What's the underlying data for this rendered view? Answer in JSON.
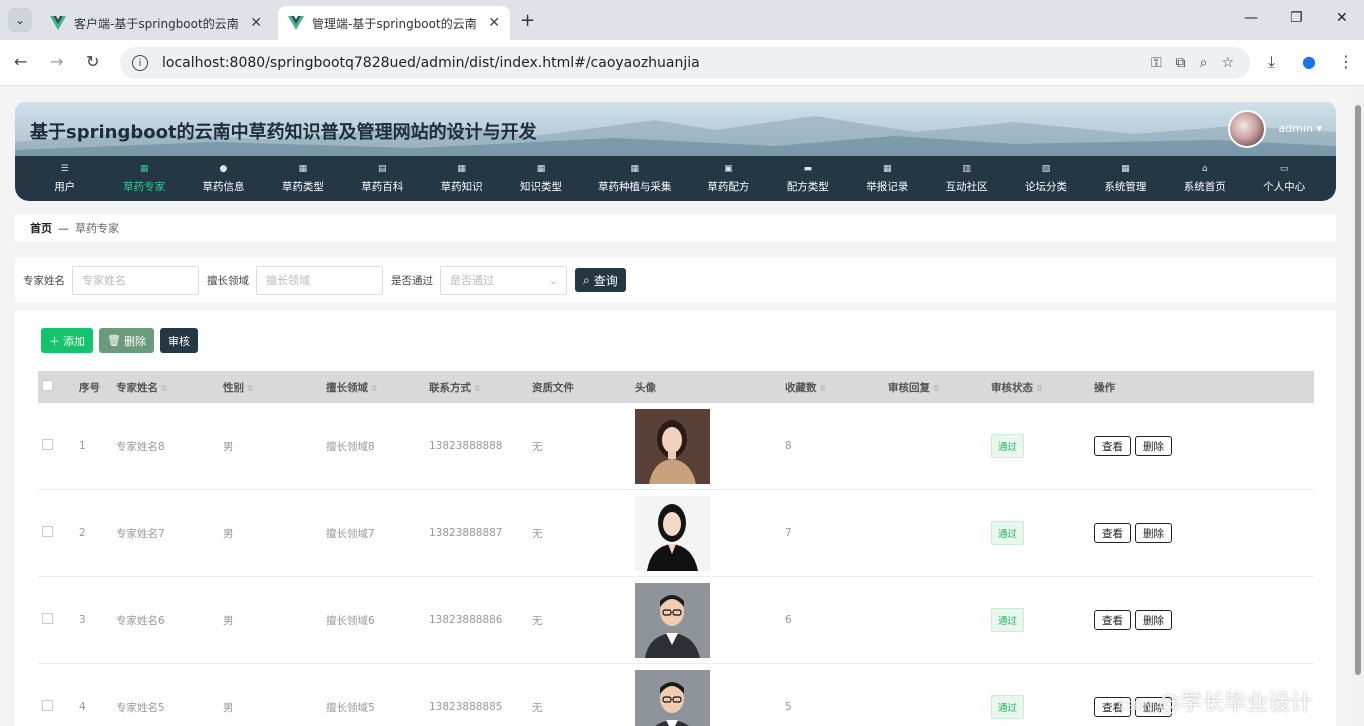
{
  "browser": {
    "tabs": [
      {
        "title": "客户端-基于springboot的云南"
      },
      {
        "title": "管理端-基于springboot的云南"
      }
    ],
    "url": "localhost:8080/springbootq7828ued/admin/dist/index.html#/caoyaozhuanjia"
  },
  "header": {
    "site_title": "基于springboot的云南中草药知识普及管理网站的设计与开发",
    "user": "admin"
  },
  "menu": [
    {
      "label": "用户",
      "icon": "list-icon"
    },
    {
      "label": "草药专家",
      "icon": "grid-icon",
      "active": true
    },
    {
      "label": "草药信息",
      "icon": "user-icon"
    },
    {
      "label": "草药类型",
      "icon": "grid-icon"
    },
    {
      "label": "草药百科",
      "icon": "doc-icon"
    },
    {
      "label": "草药知识",
      "icon": "grid-icon"
    },
    {
      "label": "知识类型",
      "icon": "grid-icon"
    },
    {
      "label": "草药种植与采集",
      "icon": "grid-icon"
    },
    {
      "label": "草药配方",
      "icon": "bag-icon"
    },
    {
      "label": "配方类型",
      "icon": "monitor-icon"
    },
    {
      "label": "举报记录",
      "icon": "grid-icon"
    },
    {
      "label": "互动社区",
      "icon": "book-icon"
    },
    {
      "label": "论坛分类",
      "icon": "clipboard-icon"
    },
    {
      "label": "系统管理",
      "icon": "grid-icon"
    },
    {
      "label": "系统首页",
      "icon": "home-icon"
    },
    {
      "label": "个人中心",
      "icon": "card-icon"
    }
  ],
  "breadcrumb": {
    "home": "首页",
    "sep": "—",
    "current": "草药专家"
  },
  "search": {
    "name_label": "专家姓名",
    "name_placeholder": "专家姓名",
    "area_label": "擅长领域",
    "area_placeholder": "擅长领域",
    "pass_label": "是否通过",
    "pass_placeholder": "是否通过",
    "query_button": "查询"
  },
  "actions": {
    "add": "添加",
    "delete": "删除",
    "audit": "审核"
  },
  "table": {
    "columns": [
      "序号",
      "专家姓名",
      "性别",
      "擅长领域",
      "联系方式",
      "资质文件",
      "头像",
      "收藏数",
      "审核回复",
      "审核状态",
      "操作"
    ],
    "rows": [
      {
        "idx": "1",
        "name": "专家姓名8",
        "gender": "男",
        "area": "擅长领域8",
        "phone": "13823888888",
        "file": "无",
        "fav": "8",
        "reply": "",
        "status": "通过",
        "photo": "woman-tan"
      },
      {
        "idx": "2",
        "name": "专家姓名7",
        "gender": "男",
        "area": "擅长领域7",
        "phone": "13823888887",
        "file": "无",
        "fav": "7",
        "reply": "",
        "status": "通过",
        "photo": "woman-black"
      },
      {
        "idx": "3",
        "name": "专家姓名6",
        "gender": "男",
        "area": "擅长领域6",
        "phone": "13823888886",
        "file": "无",
        "fav": "6",
        "reply": "",
        "status": "通过",
        "photo": "man-glasses"
      },
      {
        "idx": "4",
        "name": "专家姓名5",
        "gender": "男",
        "area": "擅长领域5",
        "phone": "13823888885",
        "file": "无",
        "fav": "5",
        "reply": "",
        "status": "通过",
        "photo": "man-glasses"
      }
    ],
    "view_label": "查看",
    "delete_label": "删除"
  },
  "watermark": {
    "prefix": "CSDN",
    "text": "@学长毕业设计"
  }
}
